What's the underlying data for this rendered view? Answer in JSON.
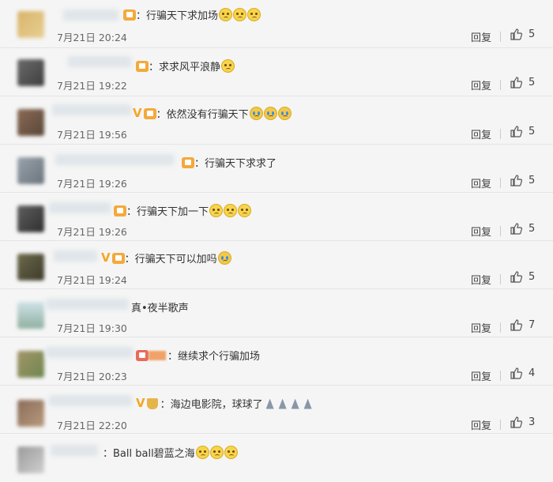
{
  "reply_label": "回复",
  "comments": [
    {
      "text": "：行骗天下求加场",
      "time": "7月21日 20:24",
      "likes": "5",
      "badge": "vip",
      "emojis": [
        "smile",
        "smile",
        "smile"
      ]
    },
    {
      "text": "：求求风平浪静",
      "time": "7月21日 19:22",
      "likes": "5",
      "badge": "vip",
      "emojis": [
        "smile"
      ]
    },
    {
      "text": "：依然没有行骗天下",
      "time": "7月21日 19:56",
      "likes": "5",
      "badge": "v-vip",
      "emojis": [
        "cry",
        "cry",
        "cry"
      ]
    },
    {
      "text": "：行骗天下求求了",
      "time": "7月21日 19:26",
      "likes": "5",
      "badge": "vip",
      "emojis": []
    },
    {
      "text": "：行骗天下加一下",
      "time": "7月21日 19:26",
      "likes": "5",
      "badge": "vip",
      "emojis": [
        "smile",
        "smile",
        "smile"
      ]
    },
    {
      "text": "：行骗天下可以加吗",
      "time": "7月21日 19:24",
      "likes": "5",
      "badge": "v-vip",
      "emojis": [
        "cry"
      ]
    },
    {
      "text": "真•夜半歌声",
      "time": "7月21日 19:30",
      "likes": "7",
      "badge": "none",
      "emojis": []
    },
    {
      "text": "：继续求个行骗加场",
      "time": "7月21日 20:23",
      "likes": "4",
      "badge": "vip-red",
      "emojis": []
    },
    {
      "text": "：海边电影院，球球了",
      "time": "7月21日 22:20",
      "likes": "3",
      "badge": "v-cup",
      "emojis": [
        "pray",
        "pray",
        "pray",
        "pray"
      ]
    },
    {
      "text": "：Ball ball碧蓝之海",
      "time": "",
      "likes": "",
      "badge": "none",
      "emojis": [
        "smile",
        "smile",
        "smile"
      ]
    }
  ],
  "colors": {
    "background": "#f5f5f5",
    "vip": "#f4a93a",
    "v_badge": "#f5a623",
    "text": "#333333",
    "time": "#666666"
  }
}
